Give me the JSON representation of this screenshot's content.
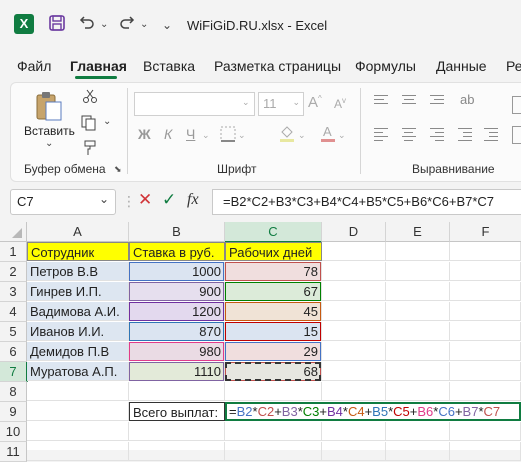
{
  "window": {
    "title": "WiFiGiD.RU.xlsx  -  Excel",
    "app_icon": "X",
    "icons": [
      "excel-logo-icon",
      "save-icon",
      "undo-icon",
      "redo-icon",
      "quick-access-dropdown-icon"
    ]
  },
  "tabs": [
    {
      "label": "Файл"
    },
    {
      "label": "Главная",
      "active": true
    },
    {
      "label": "Вставка"
    },
    {
      "label": "Разметка страницы"
    },
    {
      "label": "Формулы"
    },
    {
      "label": "Данные"
    },
    {
      "label": "Ре"
    }
  ],
  "ribbon": {
    "clipboard": {
      "paste_label": "Вставить",
      "group_label": "Буфер обмена"
    },
    "font": {
      "size_value": "11",
      "grow": "A",
      "shrink": "A",
      "bold": "Ж",
      "italic": "К",
      "underline": "Ч",
      "group_label": "Шрифт"
    },
    "alignment": {
      "group_label": "Выравнивание"
    }
  },
  "formula_bar": {
    "name_box": "C7",
    "fx_label": "fx",
    "formula": "=B2*C2+B3*C3+B4*C4+B5*C5+B6*C6+B7*C7"
  },
  "sheet": {
    "columns": [
      "A",
      "B",
      "C",
      "D",
      "E",
      "F"
    ],
    "rows": [
      "1",
      "2",
      "3",
      "4",
      "5",
      "6",
      "7",
      "8",
      "9",
      "10",
      "11"
    ],
    "header_row": [
      "Сотрудник",
      "Ставка в руб.",
      "Рабочих дней"
    ],
    "data": [
      {
        "name": "Петров В.В",
        "rate": "1000",
        "days": "78"
      },
      {
        "name": "Гинрев И.П.",
        "rate": "900",
        "days": "67"
      },
      {
        "name": "Вадимова А.И.",
        "rate": "1200",
        "days": "45"
      },
      {
        "name": "Иванов И.И.",
        "rate": "870",
        "days": "15"
      },
      {
        "name": "Демидов П.В",
        "rate": "980",
        "days": "29"
      },
      {
        "name": "Муратова А.П.",
        "rate": "1110",
        "days": "68"
      }
    ],
    "total_label": "Всего выплат:",
    "edit_tokens": [
      {
        "t": "=",
        "c": "#222222"
      },
      {
        "t": "B2",
        "c": "#4472c4"
      },
      {
        "t": "*",
        "c": "#222222"
      },
      {
        "t": "C2",
        "c": "#c0504d"
      },
      {
        "t": "+",
        "c": "#222222"
      },
      {
        "t": "B3",
        "c": "#8064a2"
      },
      {
        "t": "*",
        "c": "#222222"
      },
      {
        "t": "C3",
        "c": "#008000"
      },
      {
        "t": "+",
        "c": "#222222"
      },
      {
        "t": "B4",
        "c": "#7030a0"
      },
      {
        "t": "*",
        "c": "#222222"
      },
      {
        "t": "C4",
        "c": "#c65911"
      },
      {
        "t": "+",
        "c": "#222222"
      },
      {
        "t": "B5",
        "c": "#2e75b6"
      },
      {
        "t": "*",
        "c": "#222222"
      },
      {
        "t": "C5",
        "c": "#c00000"
      },
      {
        "t": "+",
        "c": "#222222"
      },
      {
        "t": "B6",
        "c": "#e03b8b"
      },
      {
        "t": "*",
        "c": "#222222"
      },
      {
        "t": "C6",
        "c": "#4472c4"
      },
      {
        "t": "+",
        "c": "#222222"
      },
      {
        "t": "B7",
        "c": "#8064a2"
      },
      {
        "t": "*",
        "c": "#222222"
      },
      {
        "t": "C7",
        "c": "#c0504d"
      }
    ]
  },
  "colors": {
    "accent": "#107c41",
    "header_fill": "#ffff00",
    "rate_fill": [
      "#dbe4f1",
      "#e6dfee",
      "#e3d9ee",
      "#dbe4f1",
      "#eadbe4",
      "#e3ead9"
    ],
    "days_fill": [
      "#f0dede",
      "#dcebd9",
      "#f0e3d6",
      "#dbe4f1",
      "#f0dede",
      "#e6e6e0"
    ]
  }
}
